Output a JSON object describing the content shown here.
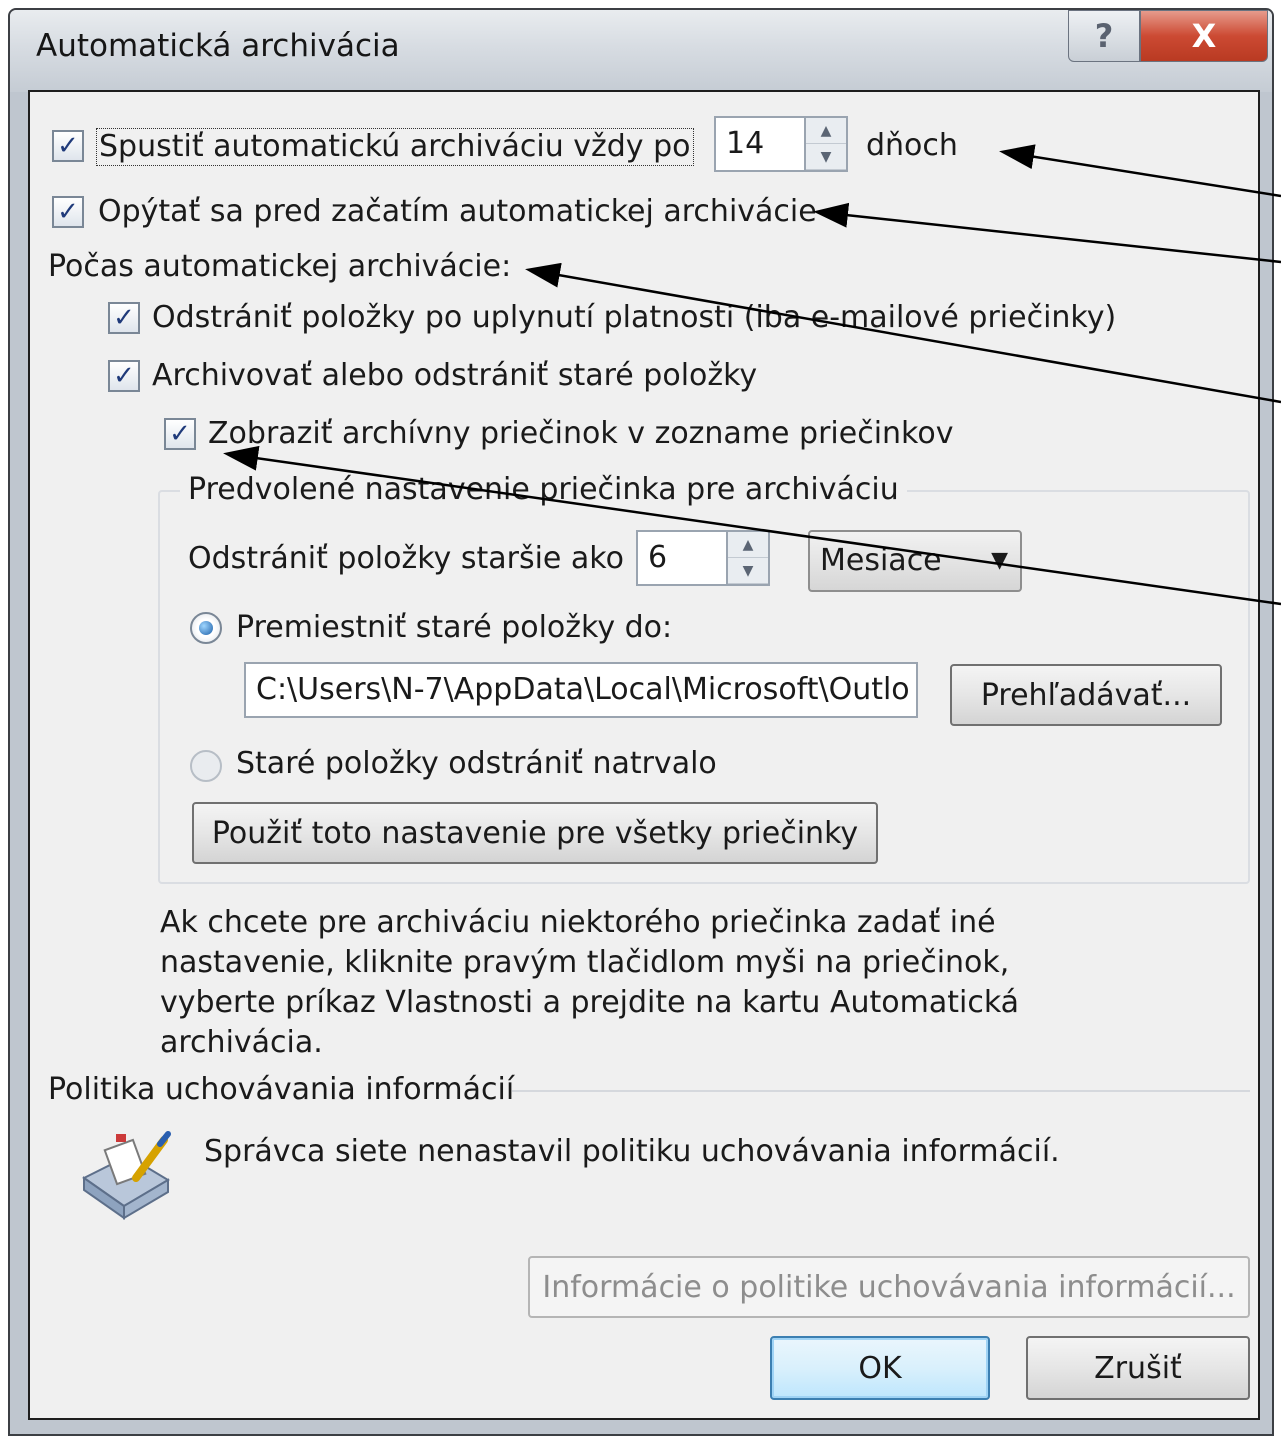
{
  "window": {
    "title": "Automatická archivácia",
    "help_label": "?",
    "close_label": "X"
  },
  "autoarchive": {
    "run_every_checked": true,
    "run_every_label": "Spustiť automatickú archiváciu vždy po",
    "days_value": "14",
    "days_unit": "dňoch",
    "prompt_checked": true,
    "prompt_label": "Opýtať sa pred začatím automatickej archivácie"
  },
  "during": {
    "heading": "Počas automatickej archivácie:",
    "delete_expired_checked": true,
    "delete_expired_label": "Odstrániť položky po uplynutí platnosti (iba e-mailové priečinky)",
    "archive_old_checked": true,
    "archive_old_label": "Archivovať alebo odstrániť staré položky",
    "show_folder_checked": true,
    "show_folder_label": "Zobraziť archívny priečinok v zozname priečinkov"
  },
  "defaults": {
    "group_title": "Predvolené nastavenie priečinka pre archiváciu",
    "older_than_label": "Odstrániť položky staršie ako",
    "older_than_value": "6",
    "period_value": "Mesiace",
    "move_option_label": "Premiestniť staré položky do:",
    "move_option_selected": true,
    "path_value": "C:\\Users\\N-7\\AppData\\Local\\Microsoft\\Outlo",
    "browse_label": "Prehľadávať...",
    "delete_option_label": "Staré položky odstrániť natrvalo",
    "delete_option_selected": false,
    "apply_all_label": "Použiť toto nastavenie pre všetky priečinky"
  },
  "info": {
    "line1": "Ak chcete pre archiváciu niektorého priečinka zadať iné",
    "line2": "nastavenie, kliknite pravým tlačidlom myši na priečinok,",
    "line3": "vyberte príkaz Vlastnosti a prejdite na kartu Automatická",
    "line4": "archivácia."
  },
  "retention": {
    "title": "Politika uchovávania informácií",
    "message": "Správca siete nenastavil politiku uchovávania informácií.",
    "policy_info_label": "Informácie o politike uchovávania informácií..."
  },
  "footer": {
    "ok_label": "OK",
    "cancel_label": "Zrušiť"
  },
  "icons": {
    "checkmark": "check-icon",
    "policy": "retention-policy-icon"
  },
  "colors": {
    "close_button": "#cc4a33",
    "dialog_background": "#f0f0f0",
    "default_button_border": "#3c7fb1"
  }
}
